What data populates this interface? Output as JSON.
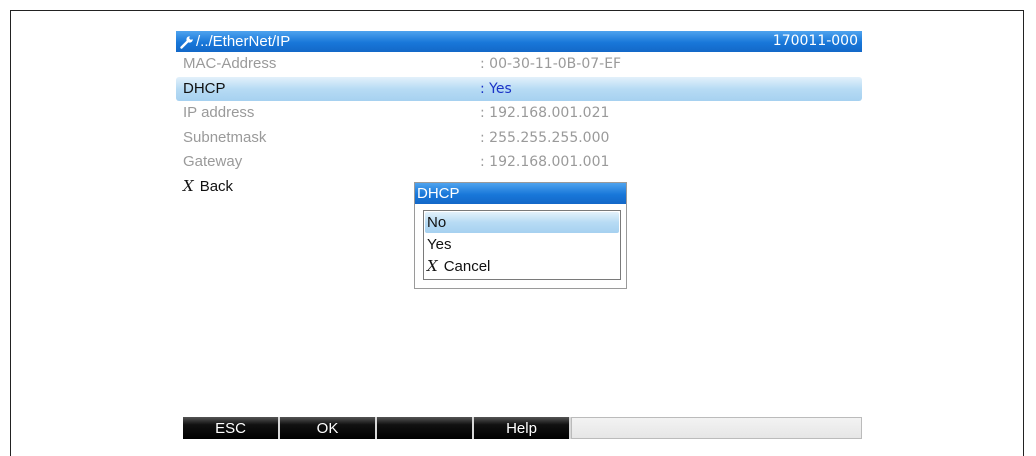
{
  "header": {
    "path": "/../EtherNet/IP",
    "code": "170011-000",
    "icon": "wrench-icon"
  },
  "rows": [
    {
      "label": "MAC-Address",
      "value": ": 00-30-11-0B-07-EF"
    },
    {
      "label": "DHCP",
      "value": ": Yes"
    },
    {
      "label": "IP address",
      "value": ": 192.168.001.021"
    },
    {
      "label": "Subnetmask",
      "value": ": 255.255.255.000"
    },
    {
      "label": "Gateway",
      "value": ": 192.168.001.001"
    }
  ],
  "back": {
    "glyph": "X",
    "label": "Back"
  },
  "dialog": {
    "title": "DHCP",
    "options": [
      "No",
      "Yes"
    ],
    "cancel": {
      "glyph": "X",
      "label": "Cancel"
    },
    "selected": "No"
  },
  "softkeys": {
    "esc": "ESC",
    "ok": "OK",
    "blank": "",
    "help": "Help"
  },
  "colors": {
    "title_bar": "#1877d9",
    "selection": "#b7dbf4",
    "selected_value": "#1a33c7",
    "inactive_text": "#9a9a9a",
    "softkey": "#000000"
  }
}
